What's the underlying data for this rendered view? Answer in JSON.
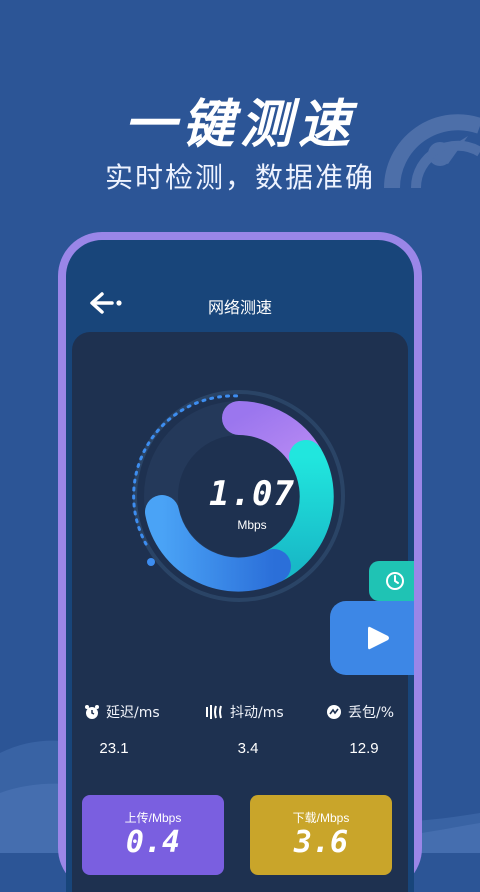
{
  "promo": {
    "title": "一键测速",
    "subtitle": "实时检测，数据准确"
  },
  "colors": {
    "background": "#2c5596",
    "phone_frame": "#9a86e8",
    "content_bg": "#1e3150",
    "gauge_purple": "#a77df0",
    "gauge_cyan": "#1ed8d8",
    "gauge_blue": "#3d8df0",
    "upload_card": "#7a5fe0",
    "download_card": "#c9a52a",
    "history_button": "#1fc3b4",
    "play_button": "#3d87e6"
  },
  "app": {
    "back_icon": "back-arrow-icon",
    "title": "网络测速"
  },
  "gauge": {
    "value": "1.07",
    "unit": "Mbps"
  },
  "metrics": [
    {
      "icon": "alarm-clock-icon",
      "label": "延迟/ms",
      "value": "23.1"
    },
    {
      "icon": "jitter-icon",
      "label": "抖动/ms",
      "value": "3.4"
    },
    {
      "icon": "packet-loss-icon",
      "label": "丢包/%",
      "value": "12.9"
    }
  ],
  "cards": {
    "upload": {
      "label": "上传/Mbps",
      "value": "0.4"
    },
    "download": {
      "label": "下载/Mbps",
      "value": "3.6"
    }
  },
  "buttons": {
    "history_icon": "clock-icon",
    "start_icon": "play-icon"
  }
}
